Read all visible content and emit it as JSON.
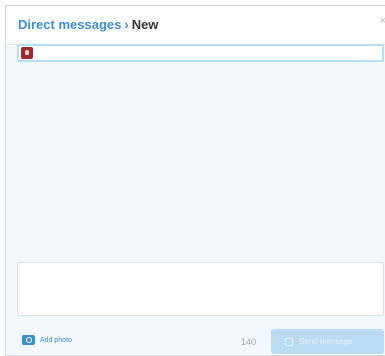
{
  "header": {
    "crumb": "Direct messages",
    "separator": "›",
    "current": "New",
    "close_glyph": "×"
  },
  "recipient": {
    "avatar_icon": "user-avatar-icon",
    "value": ""
  },
  "compose": {
    "value": ""
  },
  "footer": {
    "add_photo_icon": "camera-icon",
    "add_photo_label": "Add photo",
    "char_count": "140",
    "send_icon": "send-message-icon",
    "send_label": "Send message"
  },
  "colors": {
    "accent": "#3d8fd0",
    "panel_background": "#f3f8fc",
    "send_disabled": "#b9dcf3",
    "avatar": "#a3262d"
  }
}
